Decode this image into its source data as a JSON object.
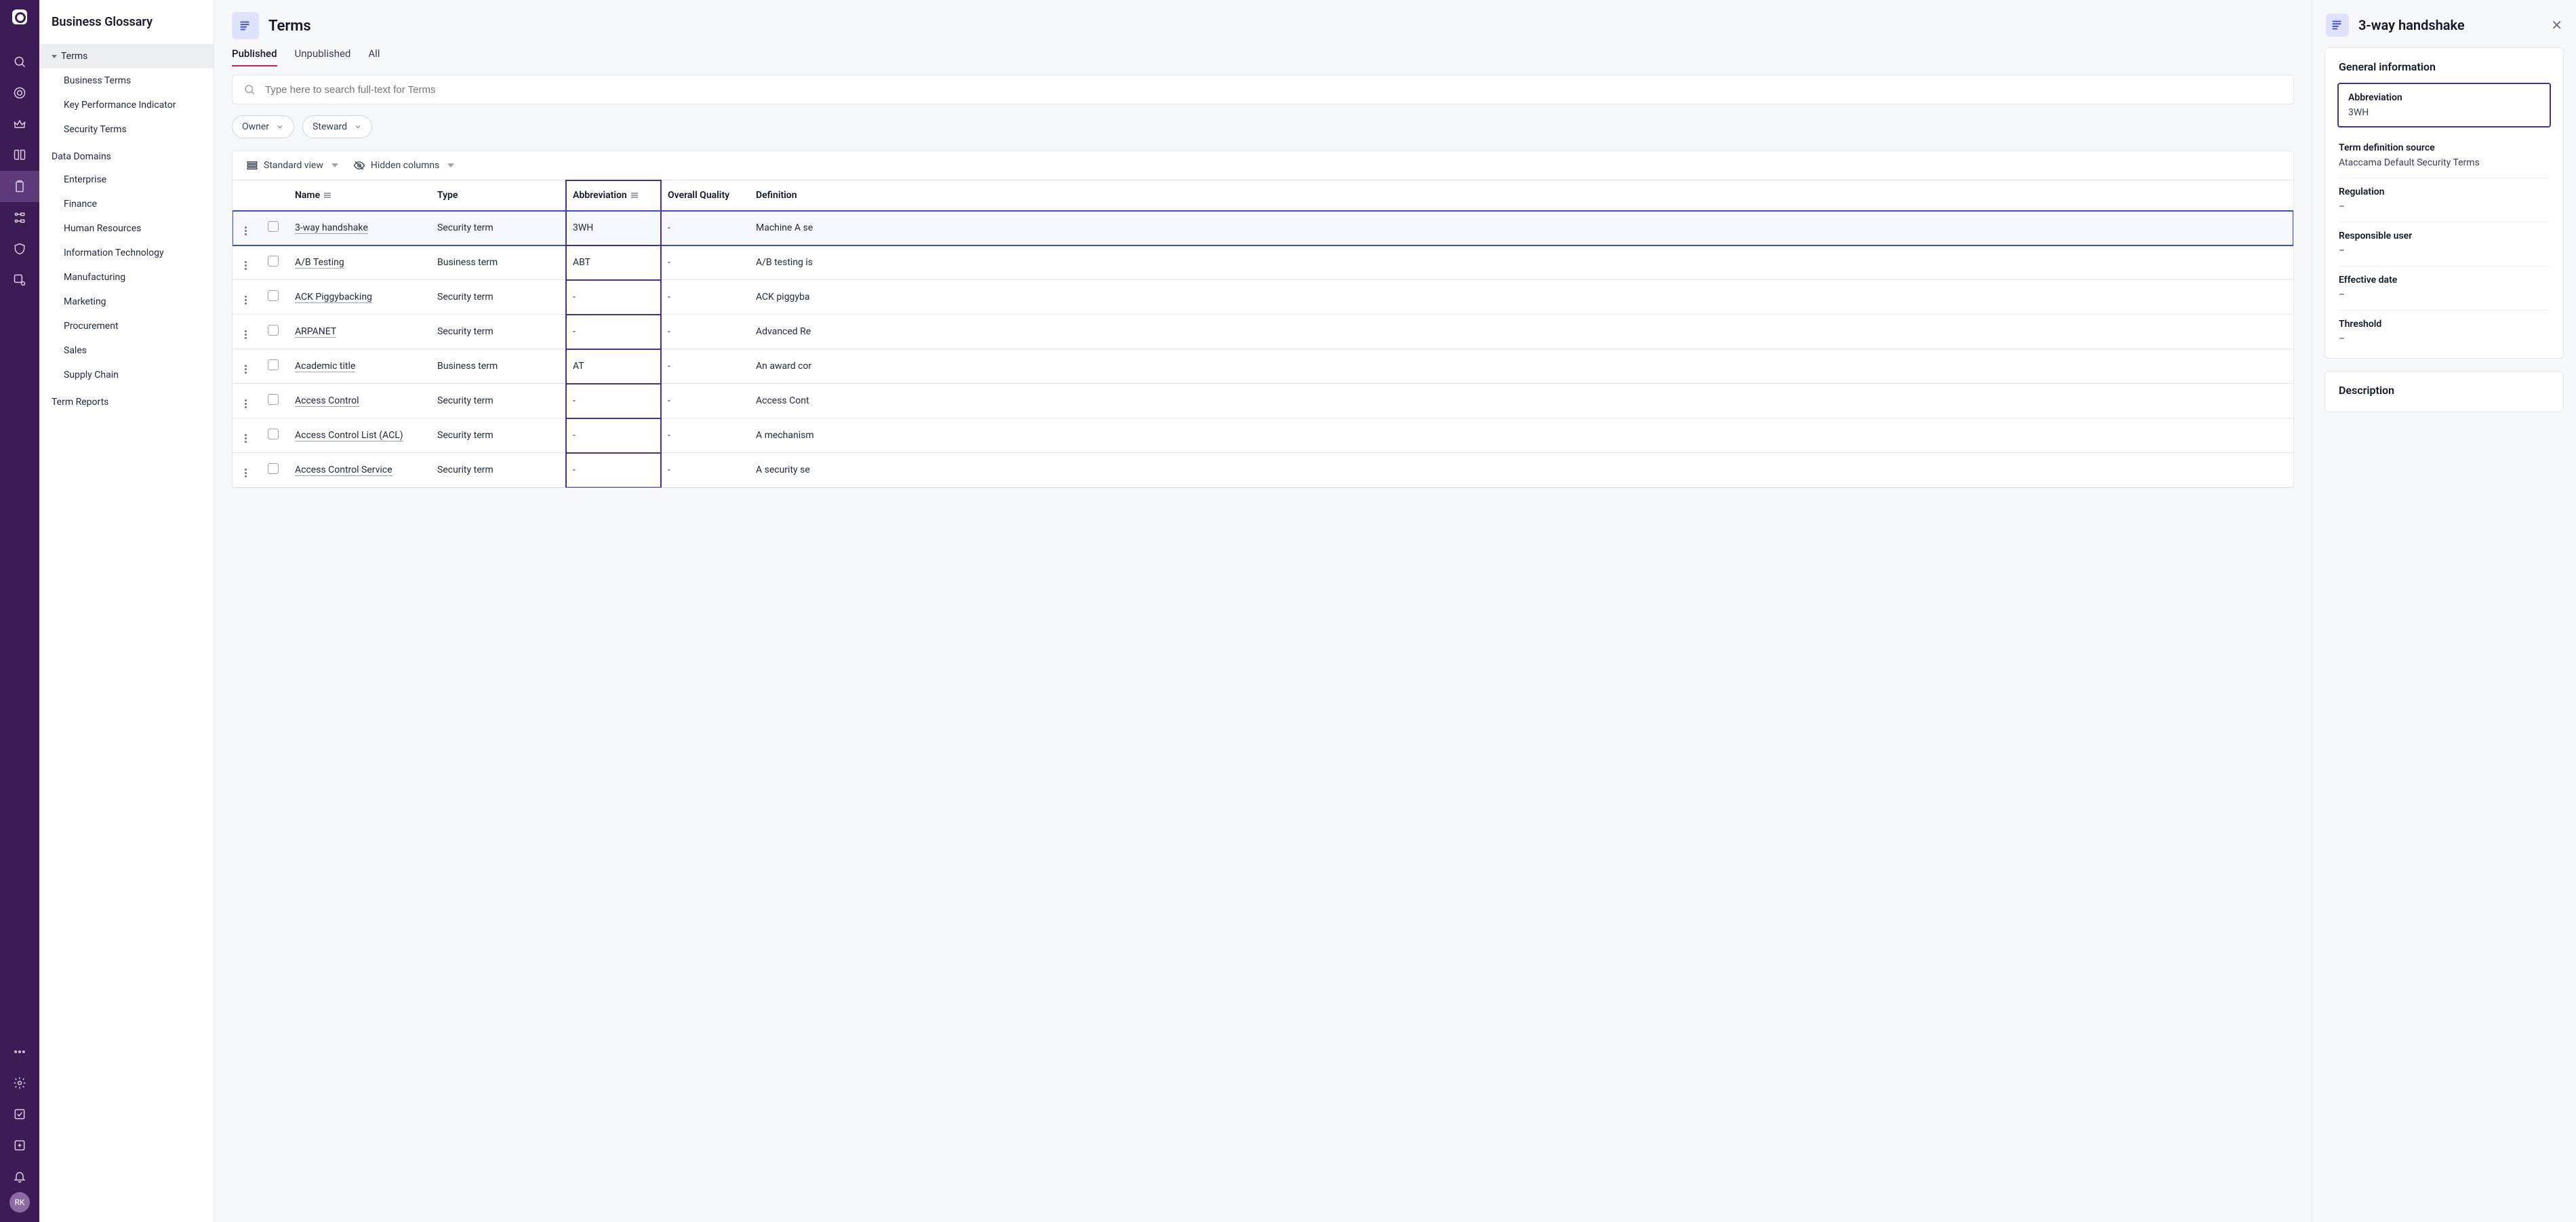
{
  "sidebar": {
    "title": "Business Glossary",
    "sections": [
      {
        "label": "Terms",
        "active": true,
        "items": [
          "Business Terms",
          "Key Performance Indicator",
          "Security Terms"
        ]
      },
      {
        "label": "Data Domains",
        "active": false,
        "items": [
          "Enterprise",
          "Finance",
          "Human Resources",
          "Information Technology",
          "Manufacturing",
          "Marketing",
          "Procurement",
          "Sales",
          "Supply Chain"
        ]
      },
      {
        "label": "Term Reports",
        "active": false,
        "items": []
      }
    ]
  },
  "rail_avatar": "RK",
  "main": {
    "title": "Terms",
    "tabs": [
      "Published",
      "Unpublished",
      "All"
    ],
    "active_tab": 0,
    "search_placeholder": "Type here to search full-text for Terms",
    "filters": [
      "Owner",
      "Steward"
    ],
    "view_label": "Standard view",
    "hidden_cols_label": "Hidden columns",
    "columns": [
      "Name",
      "Type",
      "Abbreviation",
      "Overall Quality",
      "Definition"
    ],
    "rows": [
      {
        "name": "3-way handshake",
        "type": "Security term",
        "abbr": "3WH",
        "quality": "-",
        "definition": "Machine A se",
        "selected": true
      },
      {
        "name": "A/B Testing",
        "type": "Business term",
        "abbr": "ABT",
        "quality": "-",
        "definition": "A/B testing is"
      },
      {
        "name": "ACK Piggybacking",
        "type": "Security term",
        "abbr": "-",
        "quality": "-",
        "definition": "ACK piggyba"
      },
      {
        "name": "ARPANET",
        "type": "Security term",
        "abbr": "-",
        "quality": "-",
        "definition": "Advanced Re"
      },
      {
        "name": "Academic title",
        "type": "Business term",
        "abbr": "AT",
        "quality": "-",
        "definition": "An award cor"
      },
      {
        "name": "Access Control",
        "type": "Security term",
        "abbr": "-",
        "quality": "-",
        "definition": "Access Cont"
      },
      {
        "name": "Access Control List (ACL)",
        "type": "Security term",
        "abbr": "-",
        "quality": "-",
        "definition": "A mechanism"
      },
      {
        "name": "Access Control Service",
        "type": "Security term",
        "abbr": "-",
        "quality": "-",
        "definition": "A security se"
      }
    ]
  },
  "panel": {
    "title": "3-way handshake",
    "card_title": "General information",
    "desc_title": "Description",
    "fields": [
      {
        "label": "Abbreviation",
        "value": "3WH",
        "highlight": true
      },
      {
        "label": "Term definition source",
        "value": "Ataccama Default Security Terms"
      },
      {
        "label": "Regulation",
        "value": "–"
      },
      {
        "label": "Responsible user",
        "value": "–"
      },
      {
        "label": "Effective date",
        "value": "–"
      },
      {
        "label": "Threshold",
        "value": "–"
      }
    ]
  }
}
